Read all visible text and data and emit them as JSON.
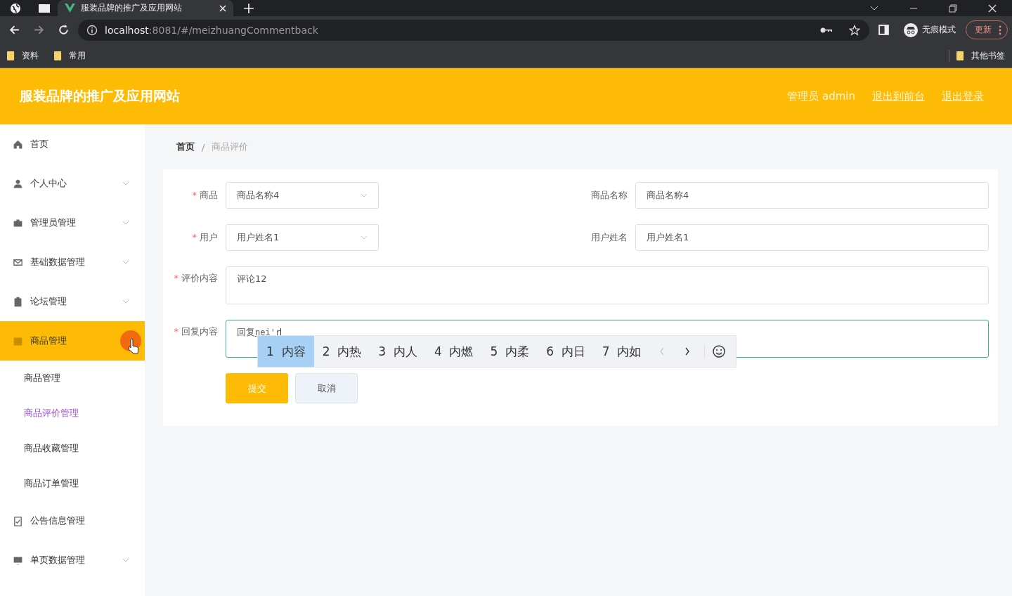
{
  "browser": {
    "tab_title": "服装品牌的推广及应用网站",
    "url_host": "localhost",
    "url_path": ":8081/#/meizhuangCommentback",
    "incognito_label": "无痕模式",
    "update_label": "更新",
    "bookmarks": [
      "资料",
      "常用"
    ],
    "other_bookmarks": "其他书签"
  },
  "header": {
    "title": "服装品牌的推广及应用网站",
    "user": "管理员 admin",
    "links": [
      "退出到前台",
      "退出登录"
    ]
  },
  "sidebar": {
    "items": [
      {
        "label": "首页",
        "expandable": false,
        "active": false
      },
      {
        "label": "个人中心",
        "expandable": true,
        "active": false
      },
      {
        "label": "管理员管理",
        "expandable": true,
        "active": false
      },
      {
        "label": "基础数据管理",
        "expandable": true,
        "active": false
      },
      {
        "label": "论坛管理",
        "expandable": true,
        "active": false
      },
      {
        "label": "商品管理",
        "expandable": true,
        "active": true,
        "children": [
          {
            "label": "商品管理",
            "selected": false
          },
          {
            "label": "商品评价管理",
            "selected": true
          },
          {
            "label": "商品收藏管理",
            "selected": false
          },
          {
            "label": "商品订单管理",
            "selected": false
          }
        ]
      },
      {
        "label": "公告信息管理",
        "expandable": false,
        "active": false
      },
      {
        "label": "单页数据管理",
        "expandable": true,
        "active": false
      }
    ]
  },
  "breadcrumb": {
    "items": [
      "首页",
      "商品评价"
    ],
    "separator": "/"
  },
  "form": {
    "required_mark": "*",
    "rows": [
      {
        "left": {
          "label": "商品",
          "required": true,
          "value": "商品名称4"
        },
        "right": {
          "label": "商品名称",
          "value": "商品名称4"
        }
      },
      {
        "left": {
          "label": "用户",
          "required": true,
          "value": "用户姓名1"
        },
        "right": {
          "label": "用户姓名",
          "value": "用户姓名1"
        }
      }
    ],
    "comment": {
      "label": "评价内容",
      "required": true,
      "value": "评论12"
    },
    "reply": {
      "label": "回复内容",
      "required": true,
      "value": "回复",
      "composition": "nei'r",
      "focused": true
    },
    "submit": "提交",
    "cancel": "取消"
  },
  "ime": {
    "candidates": [
      {
        "index": "1",
        "word": "内容",
        "selected": true
      },
      {
        "index": "2",
        "word": "内热",
        "selected": false
      },
      {
        "index": "3",
        "word": "内人",
        "selected": false
      },
      {
        "index": "4",
        "word": "内燃",
        "selected": false
      },
      {
        "index": "5",
        "word": "内柔",
        "selected": false
      },
      {
        "index": "6",
        "word": "内日",
        "selected": false
      },
      {
        "index": "7",
        "word": "内如",
        "selected": false
      }
    ],
    "prev_disabled": true,
    "next_disabled": false
  }
}
